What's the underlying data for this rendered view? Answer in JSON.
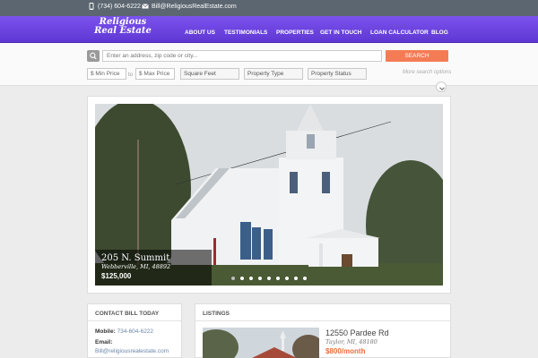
{
  "topbar": {
    "phone": "(734) 604-6222",
    "email": "Bill@ReligiousRealEstate.com"
  },
  "brand": {
    "line1": "Religious",
    "line2": "Real Estate"
  },
  "nav": [
    "ABOUT US",
    "TESTIMONIALS",
    "PROPERTIES",
    "GET IN TOUCH",
    "LOAN CALCULATOR",
    "BLOG"
  ],
  "search": {
    "placeholder": "Enter an address, zip code or city...",
    "button": "SEARCH",
    "min_price": "Min Price",
    "to": "to",
    "max_price": "Max Price",
    "square_feet": "Square Feet",
    "property_type": "Property Type",
    "property_status": "Property Status",
    "more": "More search options"
  },
  "slide": {
    "title": "205 N. Summit",
    "location": "Webberville, MI, 48892",
    "price": "$125,000",
    "dot_count": 9,
    "active_dot": 0
  },
  "contact": {
    "heading": "CONTACT BILL TODAY",
    "mobile_label": "Mobile:",
    "mobile": "734-604-6222",
    "email_label": "Email:",
    "email": "Bill@religiousrealestate.com"
  },
  "listings": {
    "heading": "LISTINGS",
    "items": [
      {
        "address": "12550 Pardee Rd",
        "location": "Taylor, MI, 48180",
        "price": "$800/month"
      }
    ]
  },
  "colors": {
    "nav_purple": "#6a42e0",
    "topbar": "#5b6670",
    "accent_orange": "#f47c55",
    "price_orange": "#f06a38"
  }
}
